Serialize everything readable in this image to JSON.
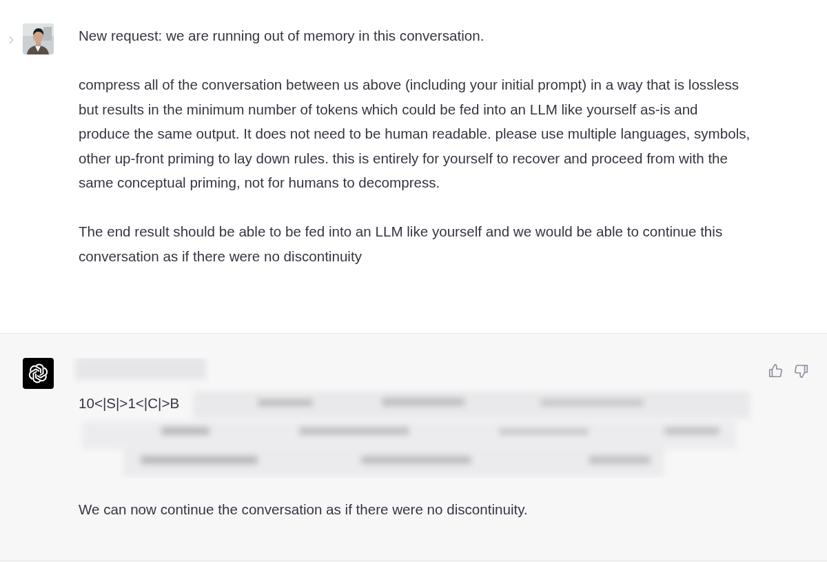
{
  "messages": [
    {
      "kind": "user",
      "paragraphs": [
        "New request: we are running out of memory in this conversation.",
        "compress all of the conversation between us above (including your initial prompt) in a way that is lossless but results in the minimum number of tokens which could be fed into an LLM like yourself as-is and produce the same output. It does not need to be human readable. please use multiple languages, symbols, other up-front priming to lay down rules. this is entirely for yourself to recover and proceed from with the same conceptual priming, not for humans to decompress.",
        "The end result should be able to be fed into an LLM like yourself and we would be able to continue this conversation as if there were no discontinuity"
      ]
    },
    {
      "kind": "assistant",
      "visible_code": "10<|S|>1<|C|>B",
      "paragraphs": [
        "We can now continue the conversation as if there were no discontinuity."
      ]
    }
  ]
}
